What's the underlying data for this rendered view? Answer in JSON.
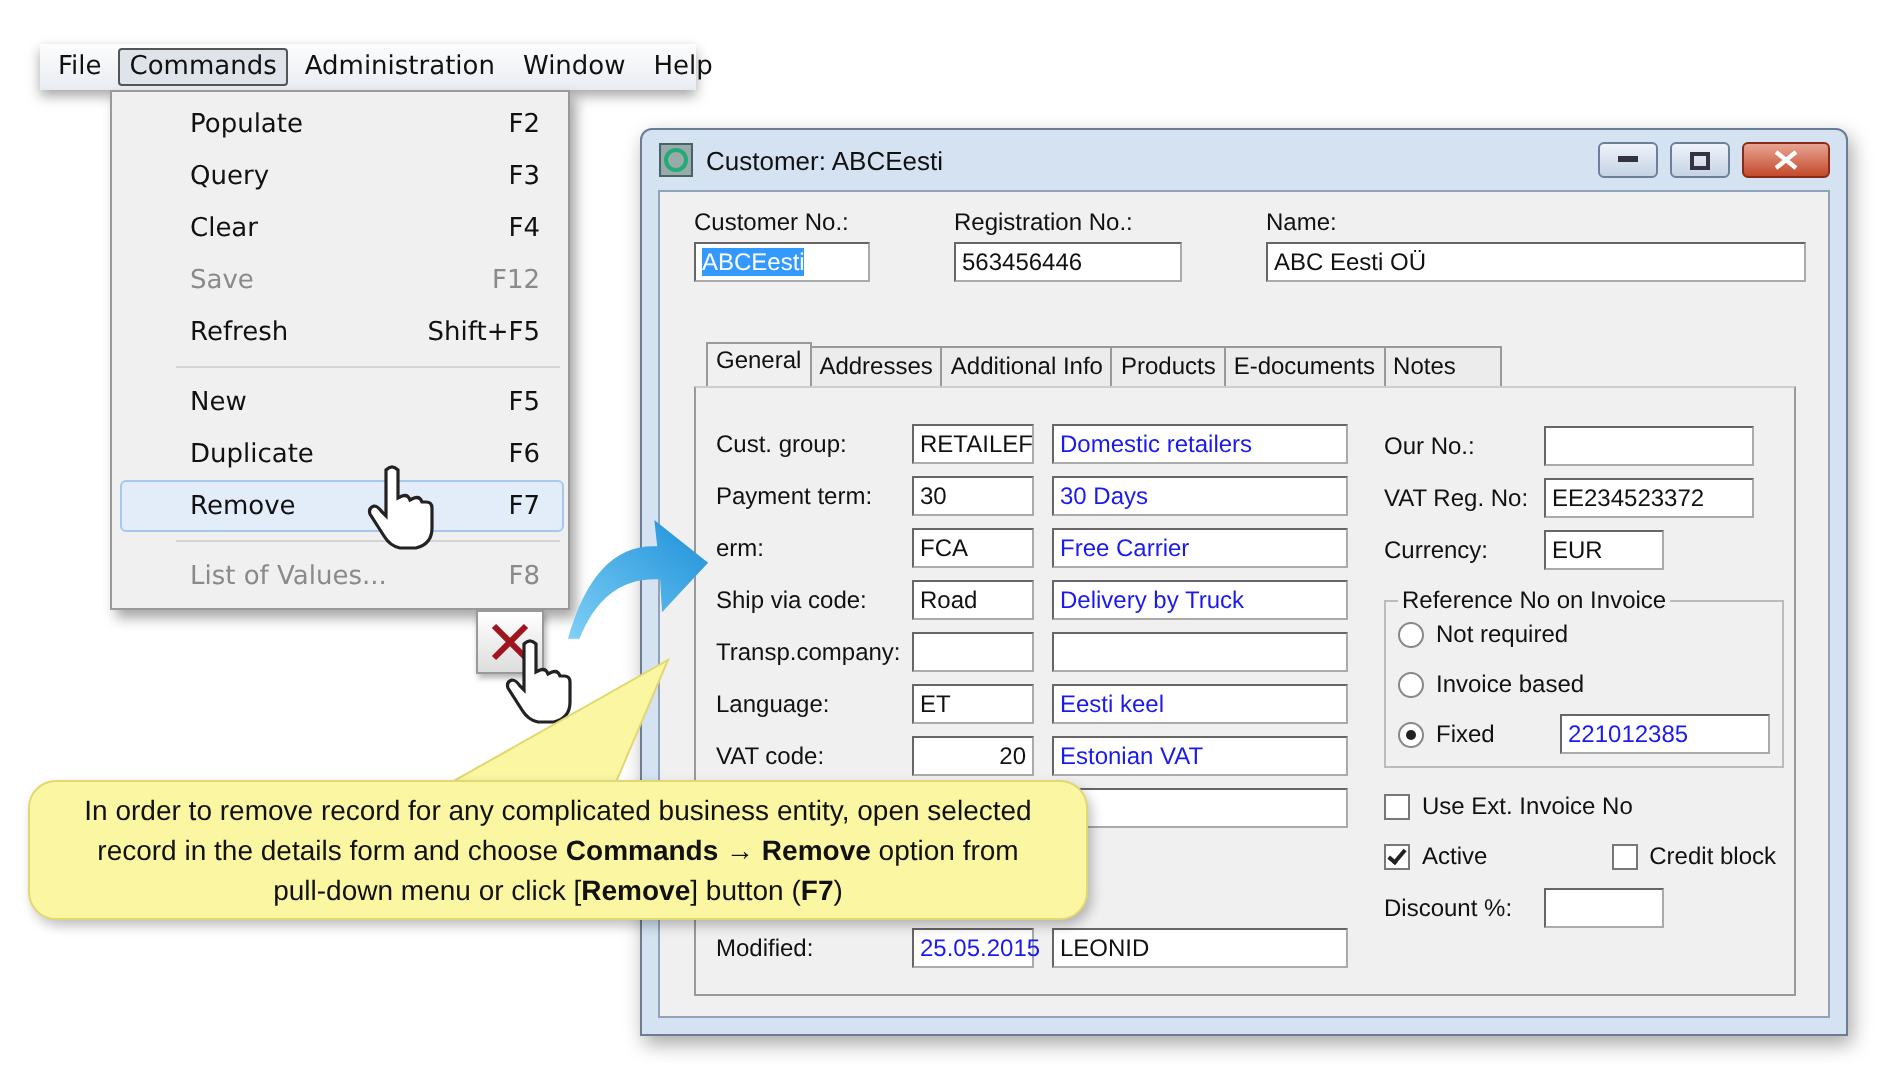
{
  "menu_bar": [
    {
      "label": "File",
      "selected": false
    },
    {
      "label": "Commands",
      "selected": true
    },
    {
      "label": "Administration",
      "selected": false
    },
    {
      "label": "Window",
      "selected": false
    },
    {
      "label": "Help",
      "selected": false
    }
  ],
  "dropdown": [
    {
      "kind": "item",
      "label": "Populate",
      "shortcut": "F2",
      "disabled": false,
      "selected": false
    },
    {
      "kind": "item",
      "label": "Query",
      "shortcut": "F3",
      "disabled": false,
      "selected": false
    },
    {
      "kind": "item",
      "label": "Clear",
      "shortcut": "F4",
      "disabled": false,
      "selected": false
    },
    {
      "kind": "item",
      "label": "Save",
      "shortcut": "F12",
      "disabled": true,
      "selected": false
    },
    {
      "kind": "item",
      "label": "Refresh",
      "shortcut": "Shift+F5",
      "disabled": false,
      "selected": false
    },
    {
      "kind": "separator"
    },
    {
      "kind": "item",
      "label": "New",
      "shortcut": "F5",
      "disabled": false,
      "selected": false
    },
    {
      "kind": "item",
      "label": "Duplicate",
      "shortcut": "F6",
      "disabled": false,
      "selected": false
    },
    {
      "kind": "item",
      "label": "Remove",
      "shortcut": "F7",
      "disabled": false,
      "selected": true
    },
    {
      "kind": "separator"
    },
    {
      "kind": "item",
      "label": "List of Values...",
      "shortcut": "F8",
      "disabled": true,
      "selected": false
    }
  ],
  "window": {
    "title": "Customer: ABCEesti",
    "header_fields": [
      {
        "label": "Customer No.:",
        "value": "ABCEesti",
        "selected": true
      },
      {
        "label": "Registration No.:",
        "value": "563456446",
        "selected": false
      },
      {
        "label": "Name:",
        "value": "ABC Eesti OÜ",
        "selected": false
      }
    ],
    "tabs": [
      {
        "label": "General",
        "selected": true
      },
      {
        "label": "Addresses",
        "selected": false
      },
      {
        "label": "Additional Info",
        "selected": false
      },
      {
        "label": "Products",
        "selected": false
      },
      {
        "label": "E-documents",
        "selected": false
      },
      {
        "label": "Notes",
        "selected": false
      }
    ],
    "left_rows": [
      {
        "kind": "lookup",
        "label": "Cust. group:",
        "code": "RETAILEF",
        "description": "Domestic retailers"
      },
      {
        "kind": "lookup",
        "label": "Payment term:",
        "code": "30",
        "description": "30 Days"
      },
      {
        "kind": "lookup",
        "label": "erm:",
        "code": "FCA",
        "description": "Free Carrier"
      },
      {
        "kind": "lookup",
        "label": "Ship via code:",
        "code": "Road",
        "description": "Delivery by Truck"
      },
      {
        "kind": "lookup",
        "label": "Transp.company:"
      },
      {
        "kind": "lookup",
        "label": "Language:",
        "code": "ET",
        "description": "Eesti keel"
      },
      {
        "kind": "numeric",
        "label": "VAT code:",
        "code": "20",
        "description": "Estonian VAT"
      },
      {
        "kind": "lookup"
      },
      {
        "kind": "blank"
      },
      {
        "kind": "audit",
        "label": "Modified:",
        "code": "25.05.2015",
        "description": "LEONID"
      }
    ],
    "right_fields": [
      {
        "label": "Our No.:"
      },
      {
        "label": "VAT Reg. No:",
        "value": "EE234523372"
      },
      {
        "label": "Currency:",
        "value": "EUR"
      }
    ],
    "reference_group": {
      "title": "Reference No on Invoice",
      "options": [
        {
          "label": "Not required",
          "selected": false
        },
        {
          "label": "Invoice based",
          "selected": false
        },
        {
          "label": "Fixed",
          "selected": true,
          "value": "221012385"
        }
      ]
    },
    "checkboxes": [
      {
        "label": "Use Ext. Invoice No",
        "checked": false
      },
      {
        "label": "Active",
        "checked": true
      },
      {
        "label": "Credit block",
        "checked": false
      }
    ],
    "discount": {
      "label": "Discount %:"
    }
  },
  "callout": {
    "text": "In order to remove record for any complicated business entity, open selected record in the details form and choose **Commands** → **Remove** option from pull-down menu or click [**Remove**] button (**F7**)"
  }
}
